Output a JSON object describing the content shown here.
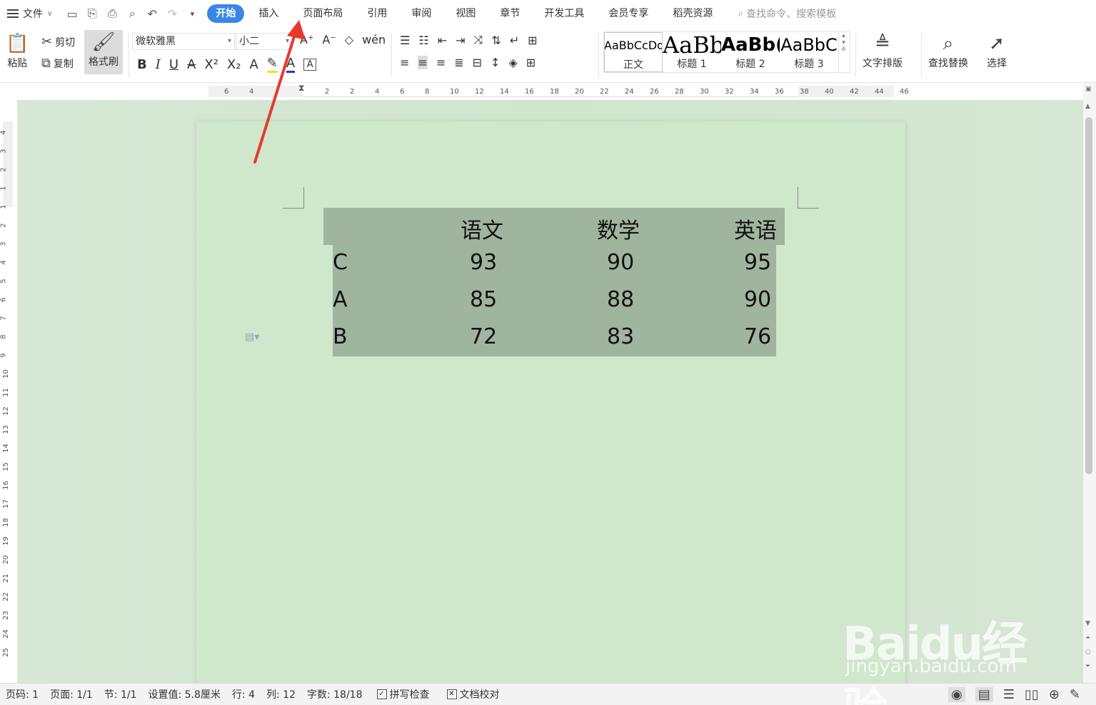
{
  "menubar": {
    "file_label": "文件",
    "tabs": [
      "开始",
      "插入",
      "页面布局",
      "引用",
      "审阅",
      "视图",
      "章节",
      "开发工具",
      "会员专享",
      "稻壳资源"
    ],
    "active_tab": "开始",
    "search_placeholder": "查找命令、搜索模板"
  },
  "ribbon": {
    "paste": "粘贴",
    "cut": "剪切",
    "copy": "复制",
    "format_painter": "格式刷",
    "font_name": "微软雅黑",
    "font_size": "小二",
    "styles": [
      {
        "preview": "AaBbCcDd",
        "name": "正文"
      },
      {
        "preview": "AaBb",
        "name": "标题 1"
      },
      {
        "preview": "AaBb(",
        "name": "标题 2"
      },
      {
        "preview": "AaBbC",
        "name": "标题 3"
      }
    ],
    "text_layout": "文字排版",
    "find_replace": "查找替换",
    "select": "选择"
  },
  "ruler": {
    "h_ticks": [
      "6",
      "4",
      "2",
      "2",
      "4",
      "6",
      "8",
      "10",
      "12",
      "14",
      "16",
      "18",
      "20",
      "22",
      "24",
      "26",
      "28",
      "30",
      "32",
      "34",
      "36",
      "38",
      "40",
      "42",
      "44",
      "46"
    ],
    "v_ticks": [
      "4",
      "3",
      "2",
      "1",
      "1",
      "2",
      "3",
      "4",
      "5",
      "6",
      "7",
      "8",
      "9",
      "10",
      "11",
      "12",
      "13",
      "14",
      "15",
      "16",
      "17",
      "18",
      "19",
      "20",
      "21",
      "22",
      "23",
      "24",
      "25"
    ]
  },
  "table": {
    "header": [
      "",
      "语文",
      "数学",
      "英语"
    ],
    "rows": [
      [
        "C",
        "93",
        "90",
        "95"
      ],
      [
        "A",
        "85",
        "88",
        "90"
      ],
      [
        "B",
        "72",
        "83",
        "76"
      ]
    ]
  },
  "statusbar": {
    "page_num": "页码: 1",
    "pages": "页面: 1/1",
    "section": "节: 1/1",
    "setting": "设置值: 5.8厘米",
    "row": "行: 4",
    "col": "列: 12",
    "word_count": "字数: 18/18",
    "spell_check": "拼写检查",
    "doc_proof": "文档校对"
  },
  "watermark": {
    "brand": "Baidu经验",
    "url": "jingyan.baidu.com"
  },
  "colors": {
    "active_tab": "#3a86e6",
    "page_bg": "#cfe7cb",
    "table_fill": "#a0b59e",
    "arrow": "#e8392f"
  }
}
